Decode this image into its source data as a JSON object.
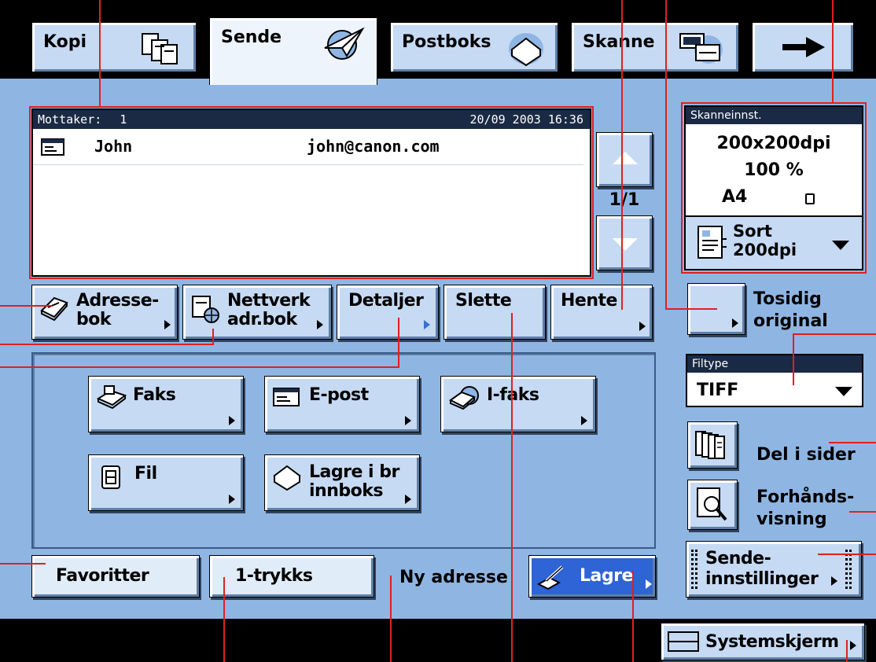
{
  "tabs": [
    {
      "label": "Kopi"
    },
    {
      "label": "Sende"
    },
    {
      "label": "Postboks"
    },
    {
      "label": "Skanne"
    }
  ],
  "recipients": {
    "header_label": "Mottaker:",
    "count": "1",
    "datetime": "20/09 2003 16:36",
    "rows": [
      {
        "name": "John",
        "email": "john@canon.com"
      }
    ],
    "page": "1/1"
  },
  "address_buttons": {
    "addressbook": [
      "Adresse-",
      "bok"
    ],
    "network": [
      "Nettverk",
      "adr.bok"
    ],
    "details": "Detaljer",
    "delete": "Slette",
    "fetch": "Hente"
  },
  "destinations": {
    "fax": "Faks",
    "email": "E-post",
    "ifax": "I-faks",
    "file": "Fil",
    "store": [
      "Lagre i br",
      "innboks"
    ]
  },
  "bottom_tabs": {
    "favorites": "Favoritter",
    "onetouch": "1-trykks",
    "new_address": "Ny adresse",
    "store": "Lagre"
  },
  "scan_settings": {
    "title": "Skanneinnst.",
    "resolution": "200x200dpi",
    "zoom": "100 %",
    "paper": "A4",
    "mode": [
      "Sort",
      "200dpi"
    ]
  },
  "duplex": [
    "Tosidig",
    "original"
  ],
  "filetype": {
    "title": "Filtype",
    "value": "TIFF"
  },
  "split": "Del i sider",
  "preview": [
    "Forhånds-",
    "visning"
  ],
  "send_settings": [
    "Sende-",
    "innstillinger"
  ],
  "system": "Systemskjerm",
  "colors": {
    "panel": "#8fb6e3",
    "button": "#c6daf3",
    "callout": "#e02020",
    "titlebar": "#1a2a44"
  }
}
